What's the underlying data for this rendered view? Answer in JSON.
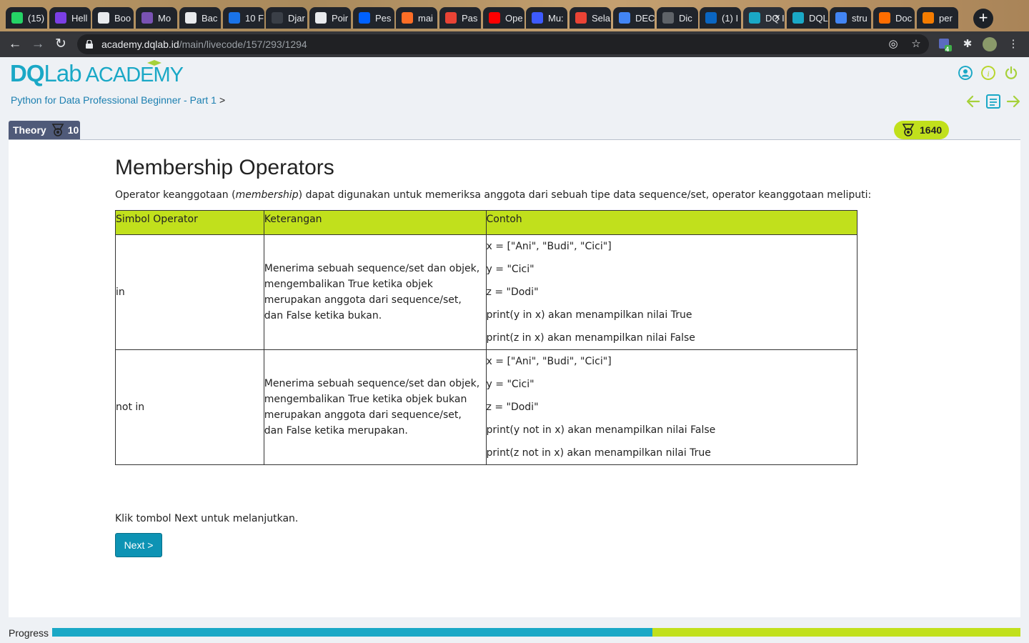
{
  "browser": {
    "tabs": [
      {
        "label": "(15)",
        "icon": "whatsapp-icon",
        "color": "#25d366"
      },
      {
        "label": "Hell",
        "icon": "hexagon-icon",
        "color": "#7b3fe4"
      },
      {
        "label": "Boo",
        "icon": "globe-icon",
        "color": "#e8eaed"
      },
      {
        "label": "Mo",
        "icon": "bootstrap-icon",
        "color": "#7952b3"
      },
      {
        "label": "Bac",
        "icon": "tool-icon",
        "color": "#e8eaed"
      },
      {
        "label": "10 F",
        "icon": "a-icon",
        "color": "#1a73e8"
      },
      {
        "label": "Djar",
        "icon": "braces-icon",
        "color": "#3a3f47"
      },
      {
        "label": "Poir",
        "icon": "globe-icon",
        "color": "#e8eaed"
      },
      {
        "label": "Pes",
        "icon": "dropbox-icon",
        "color": "#0061ff"
      },
      {
        "label": "mai",
        "icon": "gitlab-icon",
        "color": "#fc6d26"
      },
      {
        "label": "Pas",
        "icon": "gmail-icon",
        "color": "#ea4335"
      },
      {
        "label": "Ope",
        "icon": "youtube-icon",
        "color": "#ff0000"
      },
      {
        "label": "Mu:",
        "icon": "shield-icon",
        "color": "#3d5afe"
      },
      {
        "label": "Sela",
        "icon": "gmail-icon",
        "color": "#ea4335"
      },
      {
        "label": "DEC",
        "icon": "docs-icon",
        "color": "#4285f4"
      },
      {
        "label": "Dic",
        "icon": "g-icon",
        "color": "#5f6368"
      },
      {
        "label": "(1) I",
        "icon": "linkedin-icon",
        "color": "#0a66c2"
      },
      {
        "label": "DQ I",
        "icon": "dqlab-icon",
        "color": "#1aa8c6"
      },
      {
        "label": "DQL",
        "icon": "dqlab-icon",
        "color": "#1aa8c6"
      },
      {
        "label": "stru",
        "icon": "google-icon",
        "color": "#4285f4"
      },
      {
        "label": "Doc",
        "icon": "arc-icon",
        "color": "#ff6d00"
      },
      {
        "label": "per",
        "icon": "book-icon",
        "color": "#f57c00"
      }
    ],
    "active_tab_index": 17,
    "url_domain": "academy.dqlab.id",
    "url_path": "/main/livecode/157/293/1294",
    "extension_badge": "4"
  },
  "header": {
    "logo_dq": "DQ",
    "logo_lab": "Lab",
    "logo_academy": "ACADEMY",
    "breadcrumb": "Python for Data Professional Beginner - Part 1",
    "breadcrumb_sep": ">"
  },
  "badges": {
    "theory_label": "Theory",
    "theory_count": "10",
    "points": "1640"
  },
  "lesson": {
    "title": "Membership Operators",
    "intro_before": "Operator keanggotaan (",
    "intro_em": "membership",
    "intro_after": ") dapat digunakan untuk memeriksa anggota dari sebuah tipe data sequence/set, operator keanggotaan meliputi:",
    "table": {
      "headers": [
        "Simbol Operator",
        "Keterangan",
        "Contoh"
      ],
      "rows": [
        {
          "symbol": "in",
          "description": "Menerima sebuah sequence/set dan objek, mengembalikan True ketika objek merupakan anggota dari sequence/set, dan False ketika bukan.",
          "examples": [
            "x = [\"Ani\", \"Budi\", \"Cici\"]",
            "y = \"Cici\"",
            "z = \"Dodi\"",
            "print(y in x) akan menampilkan nilai   True",
            "print(z in x) akan menampilkan nilai  False"
          ]
        },
        {
          "symbol": "not in",
          "description": "Menerima sebuah sequence/set dan objek, mengembalikan True ketika objek bukan merupakan anggota dari sequence/set, dan False ketika merupakan.",
          "examples": [
            "x = [\"Ani\", \"Budi\", \"Cici\"]",
            "y = \"Cici\"",
            "z = \"Dodi\"",
            "print(y not in x) akan menampilkan nilai  False",
            "print(z not in x) akan menampilkan nilai   True"
          ]
        }
      ]
    },
    "hint": "Klik tombol Next untuk melanjutkan.",
    "next_label": "Next >"
  },
  "progress": {
    "label": "Progress",
    "fraction": 0.62
  },
  "colors": {
    "brand": "#1aa8c6",
    "accent_green": "#c1e01c",
    "theory_badge": "#4f5a79",
    "button": "#0d93b4"
  }
}
